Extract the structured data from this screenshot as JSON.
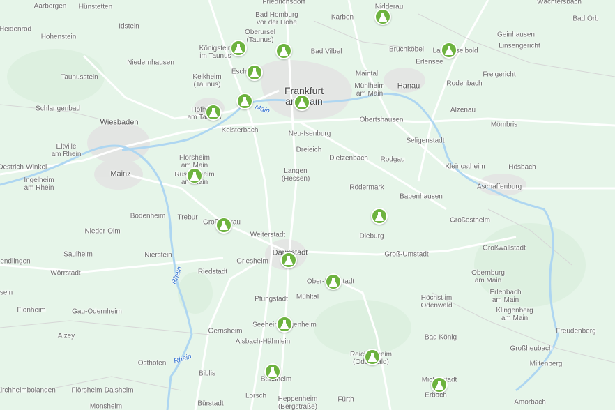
{
  "map": {
    "colors": {
      "land": "#e6f5e9",
      "urban": "#dcdcdc",
      "road": "#ffffff",
      "water": "#aed6f1",
      "river_label": "#2f6fcf",
      "marker": "#6db33f"
    },
    "marker_icon": "flask-icon",
    "rivers": [
      {
        "id": "rhein-1",
        "name": "Rhein"
      },
      {
        "id": "rhein-2",
        "name": "Rhein"
      },
      {
        "id": "main",
        "name": "Main"
      }
    ],
    "places": [
      {
        "id": "aarbergen",
        "name": "Aarbergen"
      },
      {
        "id": "huenstetten",
        "name": "Hünstetten"
      },
      {
        "id": "friedrichsdorf",
        "name": "Friedrichsdorf"
      },
      {
        "id": "waechtersbach",
        "name": "Wächtersbach"
      },
      {
        "id": "heidenrod",
        "name": "Heidenrod"
      },
      {
        "id": "idstein",
        "name": "Idstein"
      },
      {
        "id": "bad-homburg",
        "name": "Bad Homburg\nvor der Höhe"
      },
      {
        "id": "karben",
        "name": "Karben"
      },
      {
        "id": "nidderau",
        "name": "Nidderau"
      },
      {
        "id": "bad-orb",
        "name": "Bad Orb"
      },
      {
        "id": "hohenstein",
        "name": "Hohenstein"
      },
      {
        "id": "oberursel",
        "name": "Oberursel\n(Taunus)"
      },
      {
        "id": "geinhausen",
        "name": "Geinhausen"
      },
      {
        "id": "koenigstein",
        "name": "Königstein\nim Taunus"
      },
      {
        "id": "bad-vilbel",
        "name": "Bad Vilbel"
      },
      {
        "id": "bruchkoebel",
        "name": "Bruchköbel"
      },
      {
        "id": "langenselbold",
        "name": "Langenselbold"
      },
      {
        "id": "linsengericht",
        "name": "Linsengericht"
      },
      {
        "id": "niedernhausen",
        "name": "Niedernhausen"
      },
      {
        "id": "erlensee",
        "name": "Erlensee"
      },
      {
        "id": "eschborn",
        "name": "Eschborn"
      },
      {
        "id": "maintal",
        "name": "Maintal"
      },
      {
        "id": "freigericht",
        "name": "Freigericht"
      },
      {
        "id": "taunusstein",
        "name": "Taunusstein"
      },
      {
        "id": "kelkheim",
        "name": "Kelkheim\n(Taunus)"
      },
      {
        "id": "frankfurt",
        "name": "Frankfurt\nam Main"
      },
      {
        "id": "muehlheim",
        "name": "Mühlheim\nam Main"
      },
      {
        "id": "hanau",
        "name": "Hanau"
      },
      {
        "id": "rodenbach",
        "name": "Rodenbach"
      },
      {
        "id": "schlangenbad",
        "name": "Schlangenbad"
      },
      {
        "id": "hofheim",
        "name": "Hofheim\nam Taunus"
      },
      {
        "id": "alzenau",
        "name": "Alzenau"
      },
      {
        "id": "wiesbaden",
        "name": "Wiesbaden"
      },
      {
        "id": "kelsterbach",
        "name": "Kelsterbach"
      },
      {
        "id": "obertshausen",
        "name": "Obertshausen"
      },
      {
        "id": "moembris",
        "name": "Mömbris"
      },
      {
        "id": "neu-isenburg",
        "name": "Neu-Isenburg"
      },
      {
        "id": "seligenstadt",
        "name": "Seligenstadt"
      },
      {
        "id": "eltville",
        "name": "Eltville\nam Rhein"
      },
      {
        "id": "dreieich",
        "name": "Dreieich"
      },
      {
        "id": "floersheim",
        "name": "Flörsheim\nam Main"
      },
      {
        "id": "dietzenbach",
        "name": "Dietzenbach"
      },
      {
        "id": "rodgau",
        "name": "Rodgau"
      },
      {
        "id": "oestrich-winkel",
        "name": "Oestrich-Winkel"
      },
      {
        "id": "kleinostheim",
        "name": "Kleinostheim"
      },
      {
        "id": "hoesbach",
        "name": "Hösbach"
      },
      {
        "id": "mainz",
        "name": "Mainz"
      },
      {
        "id": "ruesselsheim",
        "name": "Rüsselsheim\nam Main"
      },
      {
        "id": "langen",
        "name": "Langen\n(Hessen)"
      },
      {
        "id": "ingelheim",
        "name": "Ingelheim\nam Rhein"
      },
      {
        "id": "roedermark",
        "name": "Rödermark"
      },
      {
        "id": "aschaffenburg",
        "name": "Aschaffenburg"
      },
      {
        "id": "babenhausen",
        "name": "Babenhausen"
      },
      {
        "id": "bodenheim",
        "name": "Bodenheim"
      },
      {
        "id": "trebur",
        "name": "Trebur"
      },
      {
        "id": "gross-gerau",
        "name": "Groß-Gerau"
      },
      {
        "id": "grossostheim",
        "name": "Großostheim"
      },
      {
        "id": "weiterstadt",
        "name": "Weiterstadt"
      },
      {
        "id": "nieder-olm",
        "name": "Nieder-Olm"
      },
      {
        "id": "dieburg",
        "name": "Dieburg"
      },
      {
        "id": "grosswallstadt",
        "name": "Großwallstadt"
      },
      {
        "id": "saulheim",
        "name": "Saulheim"
      },
      {
        "id": "nierstein",
        "name": "Nierstein"
      },
      {
        "id": "darmstadt",
        "name": "Darmstadt"
      },
      {
        "id": "gross-umstadt",
        "name": "Groß-Umstadt"
      },
      {
        "id": "endlingen",
        "name": "endlingen"
      },
      {
        "id": "griesheim",
        "name": "Griesheim"
      },
      {
        "id": "woerrstadt",
        "name": "Wörrstadt"
      },
      {
        "id": "riedstadt",
        "name": "Riedstadt"
      },
      {
        "id": "obernburg",
        "name": "Obernburg\nam Main"
      },
      {
        "id": "ober-ramstadt",
        "name": "Ober-Ramstadt"
      },
      {
        "id": "erlenbach",
        "name": "Erlenbach\nam Main"
      },
      {
        "id": "sein",
        "name": "sein"
      },
      {
        "id": "muehltal",
        "name": "Mühltal"
      },
      {
        "id": "pfungstadt",
        "name": "Pfungstadt"
      },
      {
        "id": "hoechst",
        "name": "Höchst im\nOdenwald"
      },
      {
        "id": "flonheim",
        "name": "Flonheim"
      },
      {
        "id": "gau-odernheim",
        "name": "Gau-Odernheim"
      },
      {
        "id": "klingenberg",
        "name": "Klingenberg\nam Main"
      },
      {
        "id": "seeheim",
        "name": "Seeheim-Jugenheim"
      },
      {
        "id": "gernsheim",
        "name": "Gernsheim"
      },
      {
        "id": "freudenberg",
        "name": "Freudenberg"
      },
      {
        "id": "alzey",
        "name": "Alzey"
      },
      {
        "id": "bad-koenig",
        "name": "Bad König"
      },
      {
        "id": "alsbach",
        "name": "Alsbach-Hähnlein"
      },
      {
        "id": "grossheubach",
        "name": "Großheubach"
      },
      {
        "id": "osthofen",
        "name": "Osthofen"
      },
      {
        "id": "reichelsheim",
        "name": "Reichelsheim\n(Odenwald)"
      },
      {
        "id": "miltenberg",
        "name": "Miltenberg"
      },
      {
        "id": "biblis",
        "name": "Biblis"
      },
      {
        "id": "bensheim",
        "name": "Bensheim"
      },
      {
        "id": "michelstadt",
        "name": "Michelstadt"
      },
      {
        "id": "kirchheimbolanden",
        "name": "Kirchheimbolanden"
      },
      {
        "id": "floersheim-dalsheim",
        "name": "Flörsheim-Dalsheim"
      },
      {
        "id": "lorsch",
        "name": "Lorsch"
      },
      {
        "id": "erbach",
        "name": "Erbach"
      },
      {
        "id": "heppenheim",
        "name": "Heppenheim\n(Bergstraße)"
      },
      {
        "id": "monsheim",
        "name": "Monsheim"
      },
      {
        "id": "buerstadt",
        "name": "Bürstadt"
      },
      {
        "id": "fuerth",
        "name": "Fürth"
      },
      {
        "id": "amorbach",
        "name": "Amorbach"
      }
    ],
    "markers": [
      {
        "id": "m-nidderau"
      },
      {
        "id": "m-oberursel"
      },
      {
        "id": "m-koenigstein"
      },
      {
        "id": "m-langenselbold"
      },
      {
        "id": "m-eschborn"
      },
      {
        "id": "m-kelkheim"
      },
      {
        "id": "m-frankfurt"
      },
      {
        "id": "m-hofheim"
      },
      {
        "id": "m-ruesselsheim"
      },
      {
        "id": "m-dieburg"
      },
      {
        "id": "m-gross-gerau"
      },
      {
        "id": "m-darmstadt"
      },
      {
        "id": "m-ober-ramstadt"
      },
      {
        "id": "m-seeheim"
      },
      {
        "id": "m-reichelsheim"
      },
      {
        "id": "m-bensheim"
      },
      {
        "id": "m-michelstadt"
      }
    ]
  }
}
